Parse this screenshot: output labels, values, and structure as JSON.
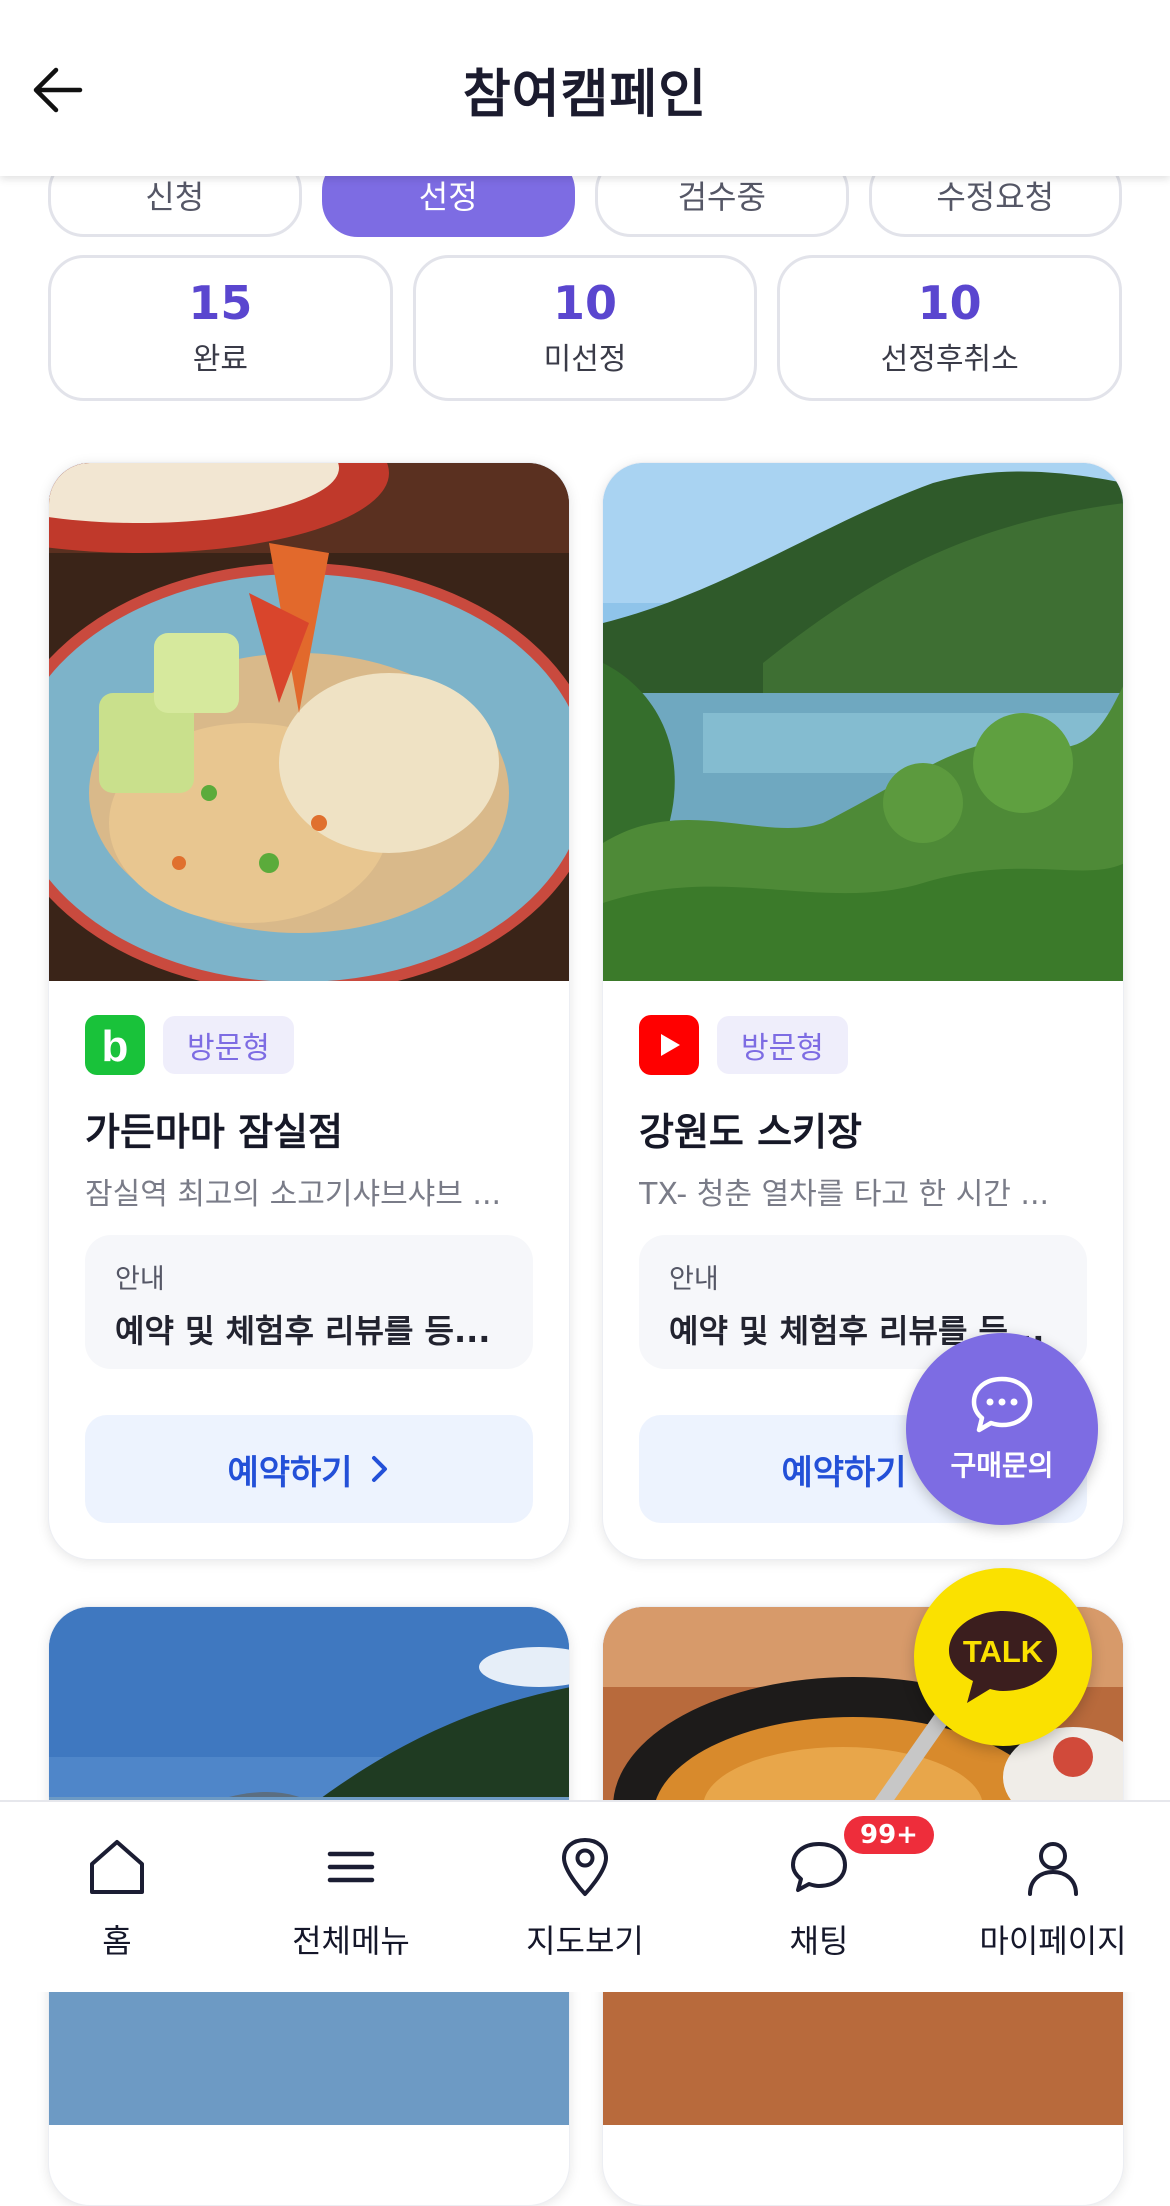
{
  "header": {
    "title": "참여캠페인",
    "back_icon": "back-arrow-icon"
  },
  "tabs": [
    {
      "label": "신청",
      "active": false
    },
    {
      "label": "선정",
      "active": true
    },
    {
      "label": "검수중",
      "active": false
    },
    {
      "label": "수정요청",
      "active": false
    }
  ],
  "stats": [
    {
      "value": "15",
      "label": "완료"
    },
    {
      "value": "10",
      "label": "미선정"
    },
    {
      "value": "10",
      "label": "선정후취소"
    }
  ],
  "cards": [
    {
      "platform_icon": "blog-icon",
      "type": "방문형",
      "title": "가든마마 잠실점",
      "desc": "잠실역 최고의 소고기샤브샤브 ...",
      "info_label": "안내",
      "info_text": "예약 및 체험후 리뷰를 등...",
      "button": "예약하기"
    },
    {
      "platform_icon": "youtube-icon",
      "type": "방문형",
      "title": "강원도 스키장",
      "desc": "TX- 청춘 열차를 타고 한 시간 ...",
      "info_label": "안내",
      "info_text": "예약 및 체험후 리뷰를 등...",
      "button": "예약하기"
    }
  ],
  "fab": {
    "inquiry_label": "구매문의",
    "talk_label": "TALK"
  },
  "nav": [
    {
      "label": "홈",
      "icon": "home-icon"
    },
    {
      "label": "전체메뉴",
      "icon": "menu-icon"
    },
    {
      "label": "지도보기",
      "icon": "map-pin-icon"
    },
    {
      "label": "채팅",
      "icon": "chat-icon",
      "badge": "99+"
    },
    {
      "label": "마이페이지",
      "icon": "user-icon"
    }
  ],
  "colors": {
    "accent": "#7d6ce3",
    "stat_number": "#5a46cf",
    "button_text": "#2350d8",
    "kakao": "#fae100",
    "badge": "#ee2d3b"
  }
}
